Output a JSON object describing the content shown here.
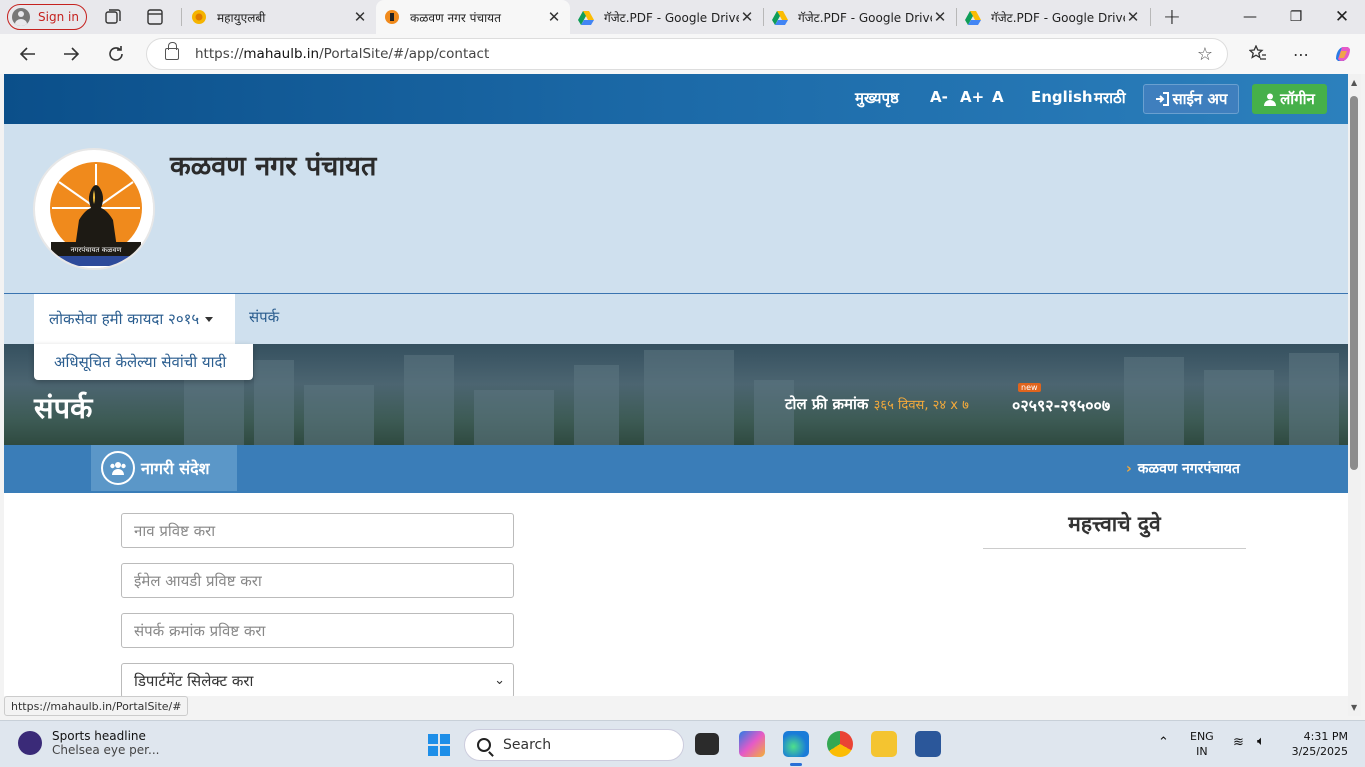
{
  "browser": {
    "signin_label": "Sign in",
    "tabs": [
      {
        "title": "महायुएलबी",
        "active": false
      },
      {
        "title": "कळवण नगर पंचायत",
        "active": true
      },
      {
        "title": "गॅजेट.PDF - Google Drive",
        "active": false
      },
      {
        "title": "गॅजेट.PDF - Google Drive",
        "active": false
      },
      {
        "title": "गॅजेट.PDF - Google Drive",
        "active": false
      }
    ],
    "new_tab": "+",
    "url_prefix": "https://",
    "url_host": "mahaulb.in",
    "url_path": "/PortalSite/#/app/contact",
    "status_url": "https://mahaulb.in/PortalSite/#"
  },
  "topbar": {
    "home": "मुख्यपृष्ठ",
    "font_minus": "A-",
    "font_plus": "A+",
    "font_normal": "A",
    "lang_en": "English",
    "lang_mr": "मराठी",
    "signup": "साईन अप",
    "login": "लॉगीन"
  },
  "header": {
    "site_title": "कळवण नगर पंचायत",
    "logo_text": "नगरपंचायत कळवण"
  },
  "menu": {
    "item1": "लोकसेवा हमी कायदा २०१५",
    "item2": "संपर्क",
    "dropdown_item": "अधिसूचित केलेल्या सेवांची यादी"
  },
  "banner": {
    "page_heading": "संपर्क",
    "tollfree_label": "टोल फ्री क्रमांक",
    "tollfree_hours": "३६५ दिवस, २४ x ७",
    "new_badge": "new",
    "phone": "०२५९२-२९५००७"
  },
  "notice": {
    "label": "नागरी संदेश",
    "ticker": "कळवण नगरपंचायत"
  },
  "form": {
    "name_placeholder": "नाव प्रविष्ट करा",
    "email_placeholder": "ईमेल आयडी प्रविष्ट करा",
    "contact_placeholder": "संपर्क क्रमांक प्रविष्ट करा",
    "department_select": "डिपार्टमेंट सिलेक्ट करा"
  },
  "sidebar": {
    "links_heading": "महत्त्वाचे दुवे"
  },
  "taskbar": {
    "news_title": "Sports headline",
    "news_sub": "Chelsea eye per...",
    "search": "Search",
    "lang1": "ENG",
    "lang2": "IN",
    "time": "4:31 PM",
    "date": "3/25/2025"
  },
  "colors": {
    "topbar": "#1c6aa8",
    "header_bg": "#cfe0ee",
    "notice_bar": "#3a7db8",
    "login_green": "#46b04a",
    "accent_orange": "#f2a93b"
  }
}
